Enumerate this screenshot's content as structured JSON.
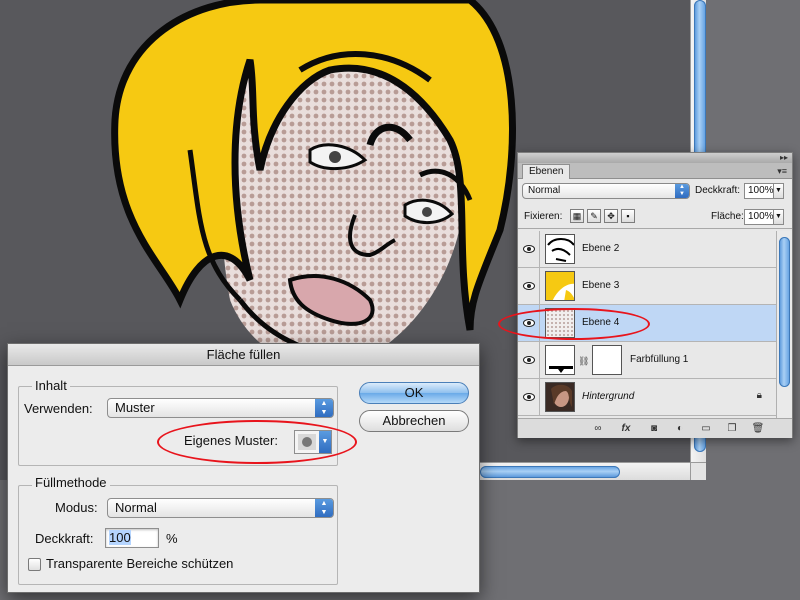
{
  "colors": {
    "accent": "#4f90d8",
    "annotation_red": "#e8141c",
    "hair_yellow": "#f6c912",
    "selected_layer": "#bfd7f5"
  },
  "layers_panel": {
    "tab_label": "Ebenen",
    "blend_mode": "Normal",
    "opacity_label": "Deckkraft:",
    "opacity_value": "100%",
    "lock_label": "Fixieren:",
    "fill_label": "Fläche:",
    "fill_value": "100%",
    "lock_icons": [
      "lock-transparency-icon",
      "lock-image-icon",
      "lock-position-icon",
      "lock-all-icon"
    ],
    "layers": [
      {
        "name": "Ebene 2",
        "selected": false,
        "thumb": "lineart"
      },
      {
        "name": "Ebene 3",
        "selected": false,
        "thumb": "yellow"
      },
      {
        "name": "Ebene 4",
        "selected": true,
        "thumb": "dots"
      },
      {
        "name": "Farbfüllung 1",
        "selected": false,
        "thumb": "fill"
      },
      {
        "name": "Hintergrund",
        "selected": false,
        "thumb": "photo"
      }
    ],
    "footer_icons": [
      "link-layers-icon",
      "fx-icon",
      "layer-mask-icon",
      "adjustment-layer-icon",
      "new-group-icon",
      "new-layer-icon",
      "trash-icon"
    ]
  },
  "dialog": {
    "title": "Fläche füllen",
    "content_group": "Inhalt",
    "use_label": "Verwenden:",
    "use_value": "Muster",
    "custom_pattern_label": "Eigenes Muster:",
    "ok_label": "OK",
    "cancel_label": "Abbrechen",
    "blending_group": "Füllmethode",
    "mode_label": "Modus:",
    "mode_value": "Normal",
    "opacity_label": "Deckkraft:",
    "opacity_value": "100",
    "opacity_unit": "%",
    "preserve_transparency_label": "Transparente Bereiche schützen",
    "preserve_transparency_checked": false
  }
}
